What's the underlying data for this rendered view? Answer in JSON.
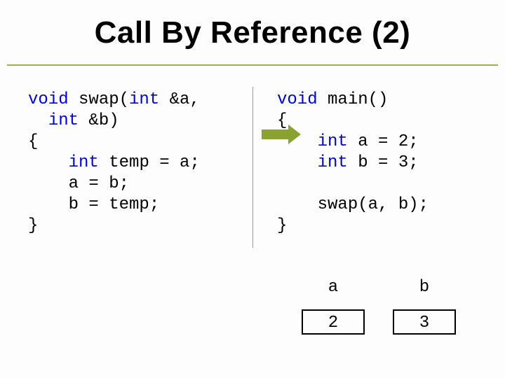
{
  "title": "Call By Reference (2)",
  "code_left": {
    "l1a": "void",
    "l1b": " swap(",
    "l1c": "int",
    "l1d": " &a,",
    "l2a": "  ",
    "l2b": "int",
    "l2c": " &b)",
    "l3": "{",
    "l4a": "    ",
    "l4b": "int",
    "l4c": " temp = a;",
    "l5": "    a = b;",
    "l6": "    b = temp;",
    "l7": "}"
  },
  "code_right": {
    "l1a": "void",
    "l1b": " main()",
    "l2": "{",
    "l3a": "    ",
    "l3b": "int",
    "l3c": " a = 2;",
    "l4a": "    ",
    "l4b": "int",
    "l4c": " b = 3;",
    "l5": "",
    "l6": "    swap(a, b);",
    "l7": "}"
  },
  "table": {
    "h1": "a",
    "h2": "b",
    "v1": "2",
    "v2": "3"
  }
}
